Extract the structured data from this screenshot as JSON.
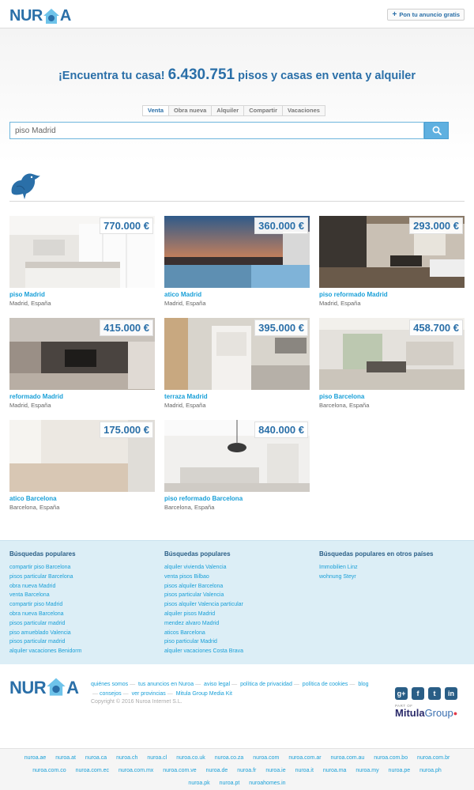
{
  "header": {
    "logo_text_left": "NUR",
    "logo_text_right": "A",
    "post_button_label": "Pon tu anuncio gratis"
  },
  "hero": {
    "headline_prefix": "¡Encuentra tu casa!",
    "headline_count": "6.430.751",
    "headline_suffix": "pisos y casas en venta y alquiler",
    "tabs": [
      "Venta",
      "Obra nueva",
      "Alquiler",
      "Compartir",
      "Vacaciones"
    ],
    "active_tab": "Venta",
    "search_value": "piso Madrid"
  },
  "listings": [
    {
      "price": "770.000 €",
      "title": "piso Madrid",
      "location": "Madrid, España"
    },
    {
      "price": "360.000 €",
      "title": "atico Madrid",
      "location": "Madrid, España"
    },
    {
      "price": "293.000 €",
      "title": "piso reformado Madrid",
      "location": "Madrid, España"
    },
    {
      "price": "415.000 €",
      "title": "reformado Madrid",
      "location": "Madrid, España"
    },
    {
      "price": "395.000 €",
      "title": "terraza Madrid",
      "location": "Madrid, España"
    },
    {
      "price": "458.700 €",
      "title": "piso Barcelona",
      "location": "Barcelona, España"
    },
    {
      "price": "175.000 €",
      "title": "atico Barcelona",
      "location": "Barcelona, España"
    },
    {
      "price": "840.000 €",
      "title": "piso reformado Barcelona",
      "location": "Barcelona, España"
    }
  ],
  "popular": {
    "col1": {
      "heading": "Búsquedas populares",
      "links": [
        "compartir piso Barcelona",
        "pisos particular Barcelona",
        "obra nueva Madrid",
        "venta Barcelona",
        "compartir piso Madrid",
        "obra nueva Barcelona",
        "pisos particular madrid",
        "piso amueblado Valencia",
        "pisos particular madrid",
        "alquiler vacaciones Benidorm"
      ]
    },
    "col2": {
      "heading": "Búsquedas populares",
      "links": [
        "alquiler vivienda Valencia",
        "venta pisos Bilbao",
        "pisos alquiler Barcelona",
        "pisos particular Valencia",
        "pisos alquiler Valencia particular",
        "alquiler pisos Madrid",
        "mendez alvaro Madrid",
        "aticos Barcelona",
        "piso particular Madrid",
        "alquiler vacaciones Costa Brava"
      ]
    },
    "col3": {
      "heading": "Búsquedas populares en otros países",
      "links": [
        "Immobilien Linz",
        "wohnung Steyr"
      ]
    }
  },
  "footer": {
    "links": [
      "quiénes somos",
      "tus anuncios en Nuroa",
      "aviso legal",
      "política de privacidad",
      "política de cookies",
      "blog",
      "consejos",
      "ver provincias",
      "Mitula Group Media Kit"
    ],
    "copyright": "Copyright © 2016 Nuroa Internet S.L.",
    "social_icons": [
      "google-plus-icon",
      "facebook-icon",
      "twitter-icon",
      "linkedin-icon"
    ],
    "mitula_part_of": "PART OF",
    "mitula_name": "Mitula",
    "mitula_group": "Group"
  },
  "domains": {
    "row1": [
      "nuroa.ae",
      "nuroa.at",
      "nuroa.ca",
      "nuroa.ch",
      "nuroa.cl",
      "nuroa.co.uk",
      "nuroa.co.za",
      "nuroa.com",
      "nuroa.com.ar",
      "nuroa.com.au",
      "nuroa.com.bo",
      "nuroa.com.br"
    ],
    "row2": [
      "nuroa.com.co",
      "nuroa.com.ec",
      "nuroa.com.mx",
      "nuroa.com.ve",
      "nuroa.de",
      "nuroa.fr",
      "nuroa.ie",
      "nuroa.it",
      "nuroa.ma",
      "nuroa.my",
      "nuroa.pe",
      "nuroa.ph"
    ],
    "row3": [
      "nuroa.pk",
      "nuroa.pt",
      "nuroahomes.in"
    ]
  },
  "colors": {
    "brand_blue": "#2a6fa8",
    "link_cyan": "#1aa0d8",
    "popular_bg": "#dceef6"
  }
}
